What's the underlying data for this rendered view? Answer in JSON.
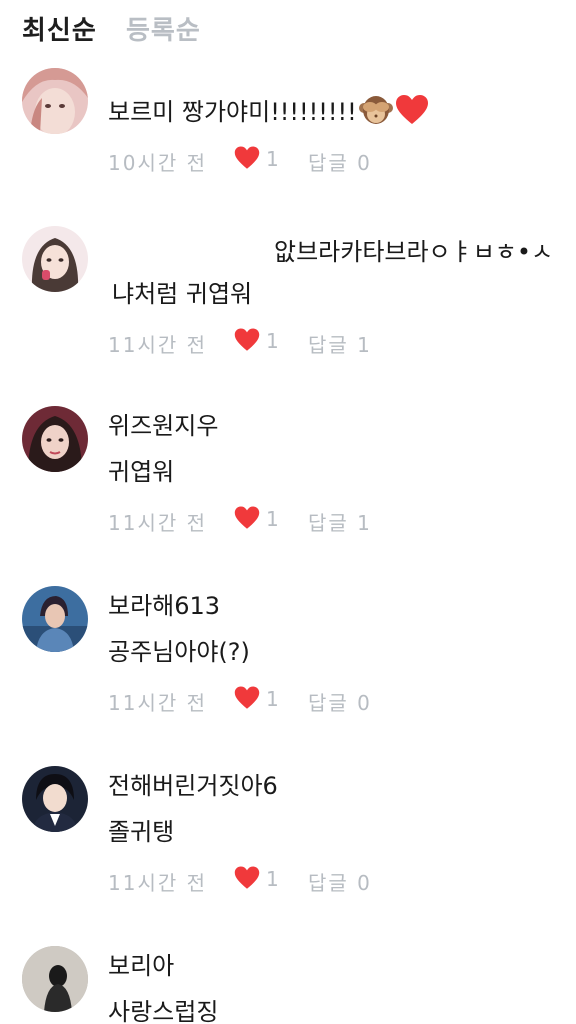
{
  "sort_tabs": {
    "latest": "최신순",
    "registered": "등록순"
  },
  "colors": {
    "heart": "#f0393b",
    "meta": "#b7bcc2",
    "inactive_tab": "#b9bec4"
  },
  "comments": [
    {
      "nickname": "",
      "text": "보르미 짱가야미!!!!!!!!!",
      "time": "10시간 전",
      "likes": "1",
      "reply": "답글 0",
      "icons": [
        "see-no-evil-monkey-icon",
        "red-heart-icon"
      ]
    },
    {
      "nickname": "앖브라카타브라ㅇㅑㅂㅎ•ㅅ",
      "text": "냐처럼 귀엽워",
      "time": "11시간 전",
      "likes": "1",
      "reply": "답글 1"
    },
    {
      "nickname": "위즈원지우",
      "text": "귀엽워",
      "time": "11시간 전",
      "likes": "1",
      "reply": "답글 1"
    },
    {
      "nickname": "보라해613",
      "text": "공주님아야(?)",
      "time": "11시간 전",
      "likes": "1",
      "reply": "답글 0"
    },
    {
      "nickname": "전해버린거짓아6",
      "text": "졸귀탱",
      "time": "11시간 전",
      "likes": "1",
      "reply": "답글 0"
    },
    {
      "nickname": "보리아",
      "text": "사랑스럽징"
    }
  ]
}
